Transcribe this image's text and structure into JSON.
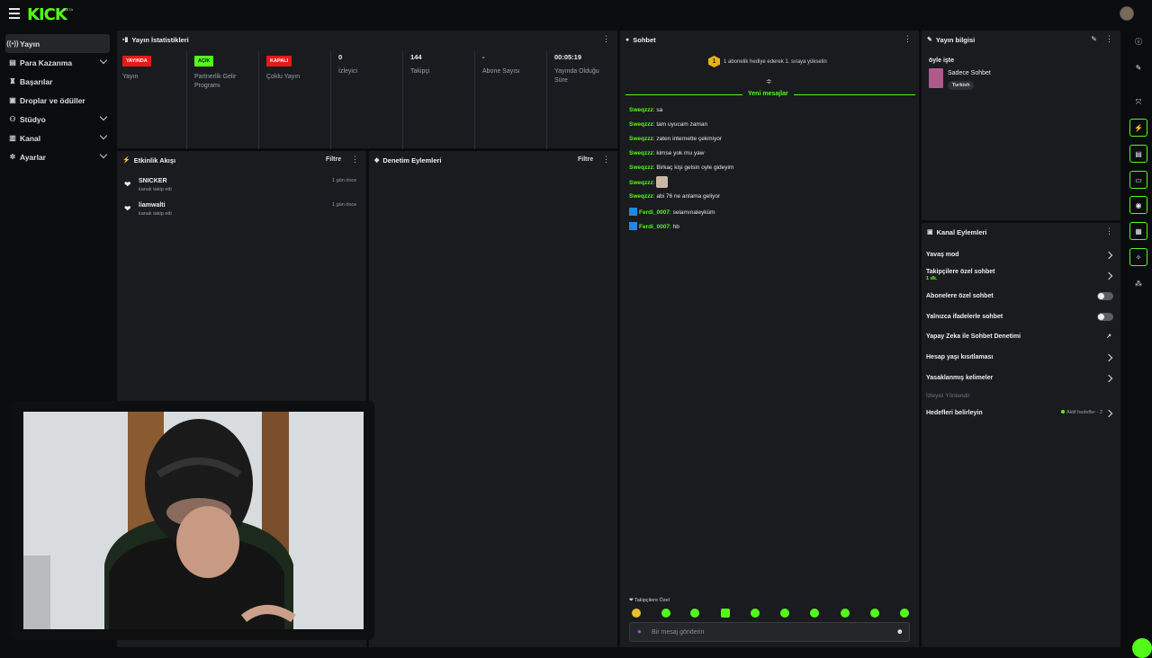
{
  "brand": {
    "logo": "KICK",
    "beta": "BETA",
    "accent": "#53fc18"
  },
  "sidebar": {
    "items": [
      {
        "label": "Yayın",
        "icon": "broadcast-icon",
        "active": true
      },
      {
        "label": "Para Kazanma",
        "icon": "wallet-icon"
      },
      {
        "label": "Başarılar",
        "icon": "trophy-icon"
      },
      {
        "label": "Droplar ve ödüller",
        "icon": "gift-icon"
      },
      {
        "label": "Stüdyo",
        "icon": "studio-icon"
      },
      {
        "label": "Kanal",
        "icon": "channel-icon"
      },
      {
        "label": "Ayarlar",
        "icon": "gear-icon"
      }
    ]
  },
  "stats": {
    "title": "Yayın İstatistikleri",
    "items": [
      {
        "badge": "YAYINDA",
        "label": "Yayın"
      },
      {
        "badge": "AÇIK",
        "label": "Partnerlik Gelir Programı"
      },
      {
        "badge": "KAPALI",
        "label": "Çoklu Yayın"
      },
      {
        "value": "0",
        "label": "İzleyici"
      },
      {
        "value": "144",
        "label": "Takipçi"
      },
      {
        "value": "-",
        "label": "Abone Sayısı"
      },
      {
        "value": "00:05:19",
        "label": "Yayında Olduğu Süre"
      }
    ]
  },
  "activity": {
    "title": "Etkinlik Akışı",
    "filter": "Filtre",
    "events": [
      {
        "name": "SNICKER",
        "sub": "kanalı takip etti",
        "time": "1 gün önce"
      },
      {
        "name": "liamwalti",
        "sub": "kanalı takip etti",
        "time": "1 gün önce"
      }
    ]
  },
  "moderation": {
    "title": "Denetim Eylemleri",
    "filter": "Filtre"
  },
  "chat": {
    "title": "Sohbet",
    "gift_count": "1",
    "gift_text": "1 abonelik hediye ederek 1. sıraya yükselin",
    "new_messages": "Yeni mesajlar",
    "messages": [
      {
        "user": "Sweqzzz",
        "text": "sa"
      },
      {
        "user": "Sweqzzz",
        "text": "tam uyucam zaman"
      },
      {
        "user": "Sweqzzz",
        "text": "zaten internette çekmiyor"
      },
      {
        "user": "Sweqzzz",
        "text": "kimse yok mu yaw"
      },
      {
        "user": "Sweqzzz",
        "text": "Birkaç kişi gelsin oyle gideyim"
      },
      {
        "user": "Sweqzzz",
        "text": ""
      },
      {
        "user": "Sweqzzz",
        "text": "abi 76 ne anlama geliyor"
      },
      {
        "user": "Ferdi_0007",
        "text": "selamınaleyküm",
        "badge": true
      },
      {
        "user": "Ferdi_0007",
        "text": "hb",
        "badge": true
      }
    ],
    "followers_only": "Takipçilere Özel",
    "placeholder": "Bir mesaj gönderin"
  },
  "stream_info": {
    "title": "Yayın bilgisi",
    "stream_title": "öyle işte",
    "category": "Sadece Sohbet",
    "tag": "Turkish"
  },
  "channel_actions": {
    "title": "Kanal Eylemleri",
    "rows": [
      {
        "label": "Yavaş mod",
        "type": "arrow"
      },
      {
        "label": "Takipçilere özel sohbet",
        "sub": "1 dk.",
        "type": "arrow"
      },
      {
        "label": "Abonelere özel sohbet",
        "type": "toggle"
      },
      {
        "label": "Yalnızca ifadelerle sohbet",
        "type": "toggle"
      },
      {
        "label": "Yapay Zeka ile Sohbet Denetimi",
        "type": "external"
      },
      {
        "label": "Hesap yaşı kısıtlaması",
        "type": "arrow"
      },
      {
        "label": "Yasaklanmış kelimeler",
        "type": "arrow"
      }
    ],
    "section": "İzleyici Yönlendir",
    "goals_label": "Hedefleri belirleyin",
    "goals_status": "Aktif hedefler - 2"
  },
  "colors": {
    "live": "#e91916",
    "on": "#53fc18",
    "off": "#e91916"
  }
}
